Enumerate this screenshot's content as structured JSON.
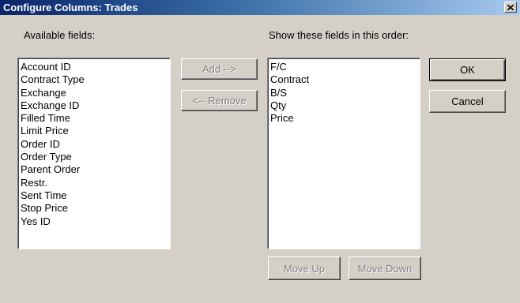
{
  "window": {
    "title": "Configure Columns: Trades",
    "close_glyph": "✕"
  },
  "available": {
    "label": "Available fields:",
    "items": [
      "Account ID",
      "Contract Type",
      "Exchange",
      "Exchange ID",
      "Filled Time",
      "Limit Price",
      "Order ID",
      "Order Type",
      "Parent Order",
      "Restr.",
      "Sent Time",
      "Stop Price",
      "Yes ID"
    ]
  },
  "selected": {
    "label": "Show these fields in this order:",
    "items": [
      "F/C",
      "Contract",
      "B/S",
      "Qty",
      "Price"
    ]
  },
  "buttons": {
    "add": "Add -->",
    "remove": "<-- Remove",
    "ok": "OK",
    "cancel": "Cancel",
    "move_up": "Move Up",
    "move_down": "Move Down"
  }
}
